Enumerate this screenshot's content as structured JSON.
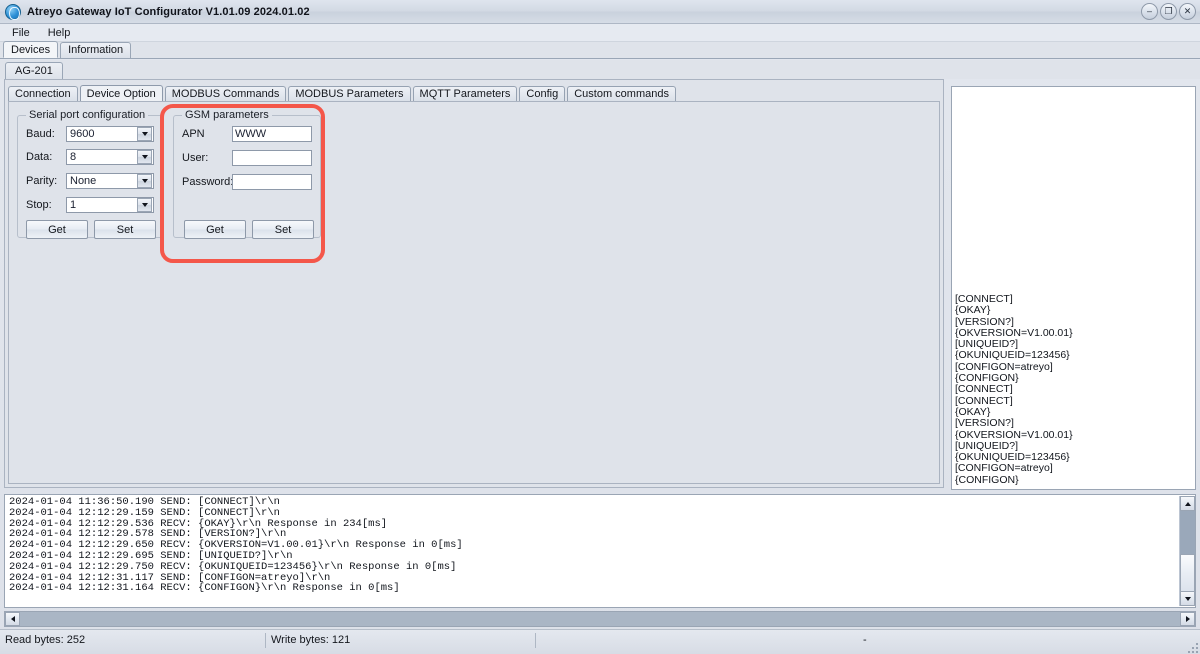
{
  "window": {
    "title": "Atreyo Gateway  IoT Configurator V1.01.09 2024.01.02",
    "app_icon": "globe-icon",
    "controls": {
      "minimize": "–",
      "restore": "❐",
      "close": "✕"
    }
  },
  "menu": {
    "items": [
      "File",
      "Help"
    ]
  },
  "outer_tabs": {
    "items": [
      {
        "label": "Devices",
        "active": true
      },
      {
        "label": "Information",
        "active": false
      }
    ]
  },
  "device_tabs": {
    "items": [
      {
        "label": "AG-201",
        "active": true
      }
    ]
  },
  "inner_tabs": {
    "items": [
      {
        "label": "Connection",
        "active": false
      },
      {
        "label": "Device Option",
        "active": true
      },
      {
        "label": "MODBUS Commands",
        "active": false
      },
      {
        "label": "MODBUS Parameters",
        "active": false
      },
      {
        "label": "MQTT Parameters",
        "active": false
      },
      {
        "label": "Config",
        "active": false
      },
      {
        "label": "Custom commands",
        "active": false
      }
    ]
  },
  "serial_group": {
    "legend": "Serial port configuration",
    "fields": [
      {
        "label": "Baud:",
        "value": "9600"
      },
      {
        "label": "Data:",
        "value": "8"
      },
      {
        "label": "Parity:",
        "value": "None"
      },
      {
        "label": "Stop:",
        "value": "1"
      }
    ],
    "get_label": "Get",
    "set_label": "Set"
  },
  "gsm_group": {
    "legend": "GSM parameters",
    "fields": [
      {
        "label": "APN",
        "value": "WWW",
        "placeholder": ""
      },
      {
        "label": "User:",
        "value": "",
        "placeholder": ""
      },
      {
        "label": "Password:",
        "value": "",
        "placeholder": ""
      }
    ],
    "get_label": "Get",
    "set_label": "Set",
    "annotation_color": "#f4574a"
  },
  "right_log": {
    "lines": [
      "[CONNECT]",
      "{OKAY}",
      "[VERSION?]",
      "{OKVERSION=V1.00.01}",
      "[UNIQUEID?]",
      "{OKUNIQUEID=123456}",
      "[CONFIGON=atreyo]",
      "{CONFIGON}",
      "[CONNECT]",
      "[CONNECT]",
      "{OKAY}",
      "[VERSION?]",
      "{OKVERSION=V1.00.01}",
      "[UNIQUEID?]",
      "{OKUNIQUEID=123456}",
      "[CONFIGON=atreyo]",
      "{CONFIGON}"
    ]
  },
  "bottom_log": {
    "lines": [
      "2024-01-04 11:36:50.190 SEND: [CONNECT]\\r\\n",
      "2024-01-04 12:12:29.159 SEND: [CONNECT]\\r\\n",
      "2024-01-04 12:12:29.536 RECV: {OKAY}\\r\\n Response in 234[ms]",
      "2024-01-04 12:12:29.578 SEND: [VERSION?]\\r\\n",
      "2024-01-04 12:12:29.650 RECV: {OKVERSION=V1.00.01}\\r\\n Response in 0[ms]",
      "2024-01-04 12:12:29.695 SEND: [UNIQUEID?]\\r\\n",
      "2024-01-04 12:12:29.750 RECV: {OKUNIQUEID=123456}\\r\\n Response in 0[ms]",
      "2024-01-04 12:12:31.117 SEND: [CONFIGON=atreyo]\\r\\n",
      "2024-01-04 12:12:31.164 RECV: {CONFIGON}\\r\\n Response in 0[ms]"
    ]
  },
  "statusbar": {
    "read_bytes": "Read bytes: 252",
    "write_bytes": "Write bytes: 121",
    "extra": "-"
  }
}
